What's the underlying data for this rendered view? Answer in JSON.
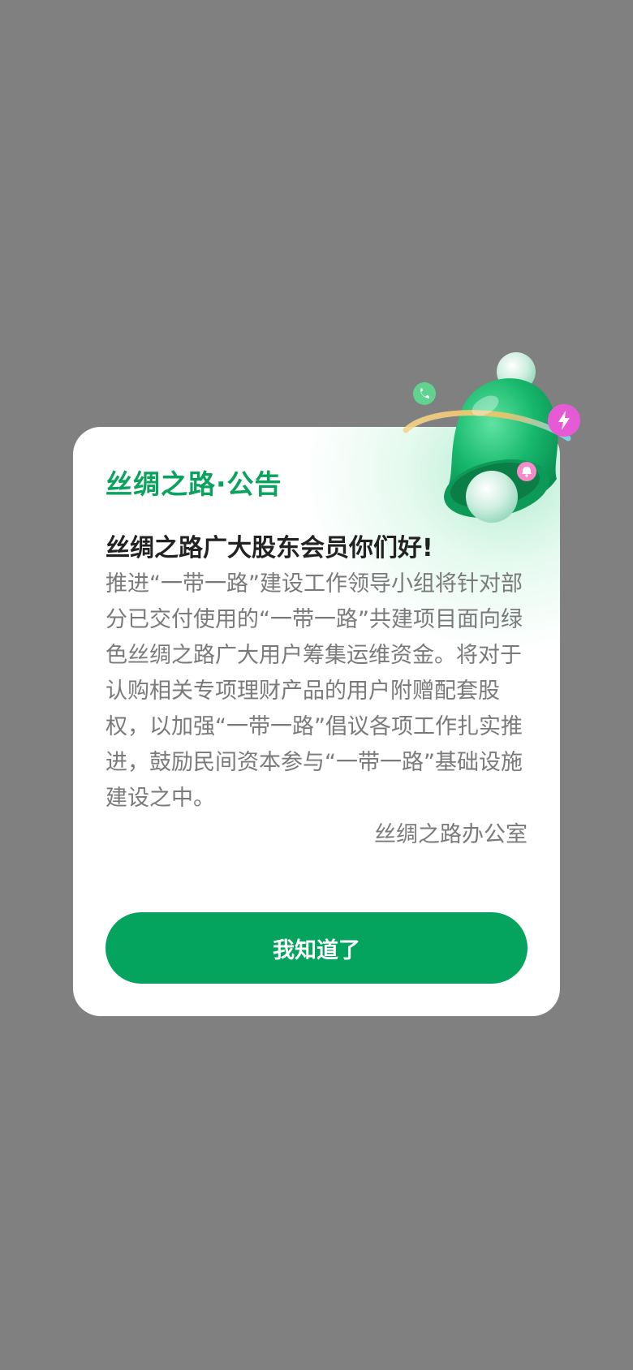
{
  "dialog": {
    "title": "丝绸之路·公告",
    "greeting": "丝绸之路广大股东会员你们好!",
    "body": "推进“一带一路”建设工作领导小组将针对部分已交付使用的“一带一路”共建项目面向绿色丝绸之路广大用户筹集运维资金。将对于认购相关专项理财产品的用户附赠配套股权，以加强“一带一路”倡议各项工作扎实推进，鼓励民间资本参与“一带一路”基础设施建设之中。",
    "signature": "丝绸之路办公室",
    "confirm_label": "我知道了"
  },
  "colors": {
    "overlay": "#808080",
    "accent": "#04a45f",
    "title": "#0aa35e",
    "greeting": "#222222",
    "body": "#7a7a7a"
  },
  "icons": [
    "bell-icon",
    "phone-icon",
    "lightning-icon",
    "notification-icon"
  ]
}
